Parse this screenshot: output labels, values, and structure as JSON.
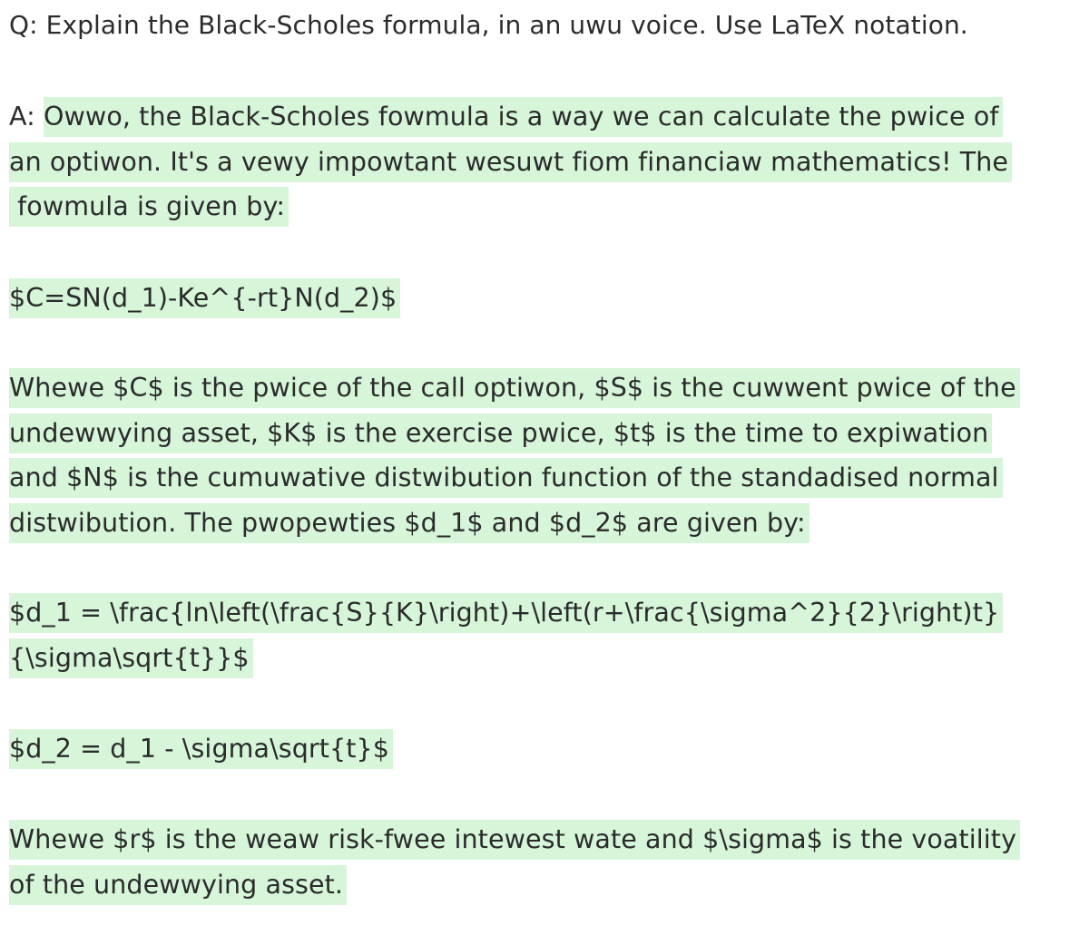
{
  "question": "Q: Explain the Black-Scholes formula, in an uwu voice. Use LaTeX notation.",
  "answer": {
    "prefix": "A: ",
    "intro_lines": [
      "Owwo, the Black-Scholes fowmula is a way we can calculate the pwice of",
      "an optiwon. It's a vewy impowtant wesuwt fiom financiaw mathematics! The",
      " fowmula is given by:"
    ],
    "formula_main": "$C=SN(d_1)-Ke^{-rt}N(d_2)$",
    "definitions_lines": [
      "Whewe $C$ is the pwice of the call optiwon, $S$ is the cuwwent pwice of the",
      "undewwying asset, $K$ is the exercise pwice, $t$ is the time to expiwation",
      "and $N$ is the cumuwative distwibution function of the standadised normal",
      "distwibution. The pwopewties $d_1$ and $d_2$ are given by:"
    ],
    "formula_d1_lines": [
      "$d_1 = \\frac{ln\\left(\\frac{S}{K}\\right)+\\left(r+\\frac{\\sigma^2}{2}\\right)t}",
      "{\\sigma\\sqrt{t}}$"
    ],
    "formula_d2": "$d_2 = d_1 - \\sigma\\sqrt{t}$",
    "closing_lines": [
      "Whewe $r$ is the weaw risk-fwee intewest wate and $\\sigma$ is the voatility",
      "of the undewwying asset."
    ]
  }
}
